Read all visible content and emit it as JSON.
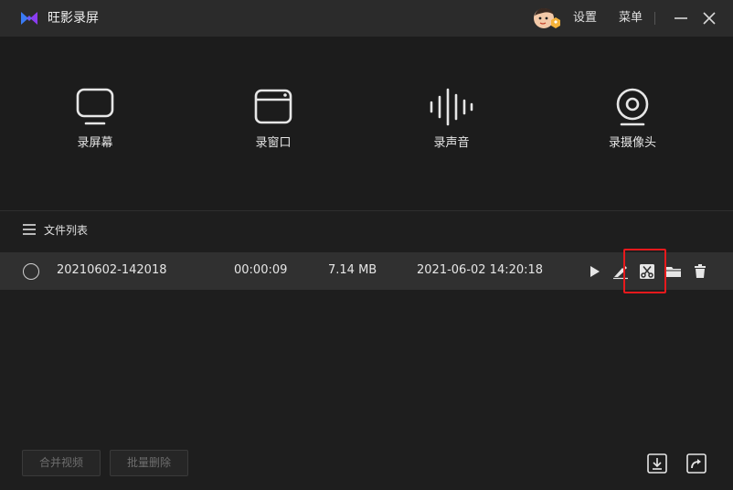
{
  "app": {
    "title": "旺影录屏"
  },
  "titlebar": {
    "settings_label": "设置",
    "menu_label": "菜单"
  },
  "modes": [
    {
      "label": "录屏幕",
      "icon": "monitor-icon"
    },
    {
      "label": "录窗口",
      "icon": "window-icon"
    },
    {
      "label": "录声音",
      "icon": "sound-wave-icon"
    },
    {
      "label": "录摄像头",
      "icon": "webcam-icon"
    }
  ],
  "file_list": {
    "title": "文件列表",
    "rows": [
      {
        "name": "20210602-142018",
        "duration": "00:00:09",
        "size": "7.14 MB",
        "date": "2021-06-02 14:20:18",
        "selected": false,
        "actions": [
          "play-icon",
          "edit-icon",
          "cut-icon",
          "folder-icon",
          "delete-icon"
        ]
      }
    ]
  },
  "bottom": {
    "merge_label": "合并视频",
    "batch_delete_label": "批量删除"
  },
  "colors": {
    "background": "#1e1e1e",
    "titlebar": "#2b2b2b",
    "row": "#303030",
    "highlight": "#e8191c",
    "logo_blue": "#3a7bf5",
    "logo_purple": "#8b3df0"
  }
}
